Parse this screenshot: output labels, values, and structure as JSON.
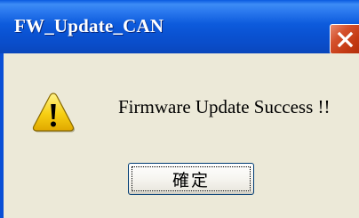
{
  "window": {
    "title": "FW_Update_CAN",
    "close_icon": "close-icon",
    "icon": "warning-icon",
    "message": "Firmware Update Success !!",
    "ok_button_label": "確定"
  },
  "colors": {
    "title_bar": "#0a52d2",
    "client_background": "#ece9d8",
    "close_button": "#c43a13",
    "warning_yellow": "#f7c600"
  }
}
